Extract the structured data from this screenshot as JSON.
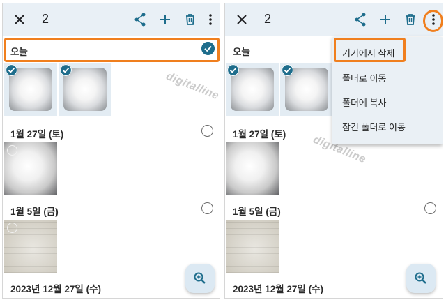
{
  "colors": {
    "accent": "#1e6d8c",
    "highlight": "#f07f1e",
    "topbar": "#e9f0f6"
  },
  "left_panel": {
    "count": "2",
    "icons": [
      "close-icon",
      "share-icon",
      "add-icon",
      "trash-icon",
      "more-vert-icon"
    ],
    "sections": [
      {
        "label": "오늘",
        "state": "checked"
      },
      {
        "label": "1월 27일 (토)",
        "state": "unchecked"
      },
      {
        "label": "1월 5일 (금)",
        "state": "unchecked"
      },
      {
        "label": "2023년 12월 27일 (수)",
        "state": "none"
      }
    ],
    "watermark": "digitalline"
  },
  "right_panel": {
    "count": "2",
    "icons": [
      "close-icon",
      "share-icon",
      "add-icon",
      "trash-icon",
      "more-vert-icon"
    ],
    "sections": [
      {
        "label": "오늘"
      },
      {
        "label": "1월 27일 (토)"
      },
      {
        "label": "1월 5일 (금)"
      },
      {
        "label": "2023년 12월 27일 (수)"
      }
    ],
    "menu": [
      {
        "label": "기기에서 삭제"
      },
      {
        "label": "폴더로 이동"
      },
      {
        "label": "폴더에 복사"
      },
      {
        "label": "잠긴 폴더로 이동"
      }
    ],
    "watermark": "digitalline"
  }
}
